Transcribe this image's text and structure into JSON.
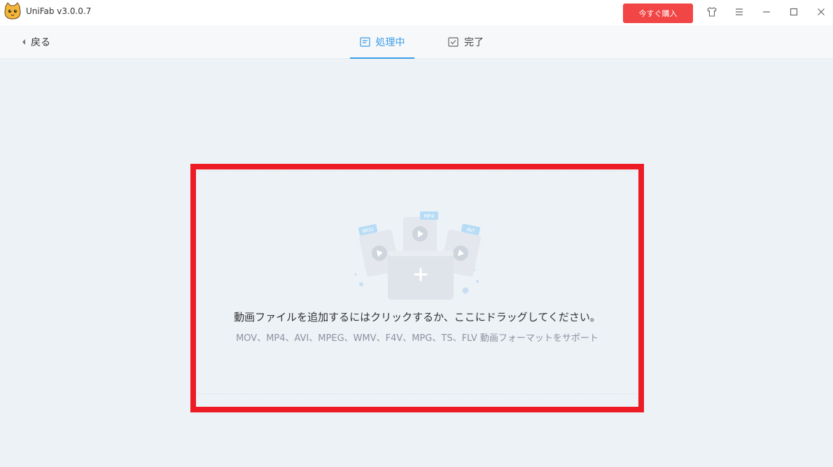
{
  "app": {
    "title": "UniFab v3.0.0.7"
  },
  "titlebar": {
    "buy_label": "今すぐ購入"
  },
  "navbar": {
    "back_label": "戻る",
    "tabs": [
      {
        "label": "処理中",
        "active": true
      },
      {
        "label": "完了",
        "active": false
      }
    ]
  },
  "dropzone": {
    "main_text": "動画ファイルを追加するにはクリックするか、ここにドラッグしてください。",
    "sub_text": "MOV、MP4、AVI、MPEG、WMV、F4V、MPG、TS、FLV 動画フォーマットをサポート",
    "format_tags": [
      "MOV",
      "MP4",
      "AVI"
    ]
  },
  "colors": {
    "accent": "#3a9ce8",
    "buy": "#f24545",
    "highlight": "#ed1c24",
    "background": "#edf2f7"
  },
  "icons": [
    "cat-logo-icon",
    "shirt-icon",
    "menu-icon",
    "minimize-icon",
    "maximize-icon",
    "close-icon",
    "chevron-left-icon",
    "list-icon",
    "checkbox-icon",
    "add-file-icon"
  ]
}
